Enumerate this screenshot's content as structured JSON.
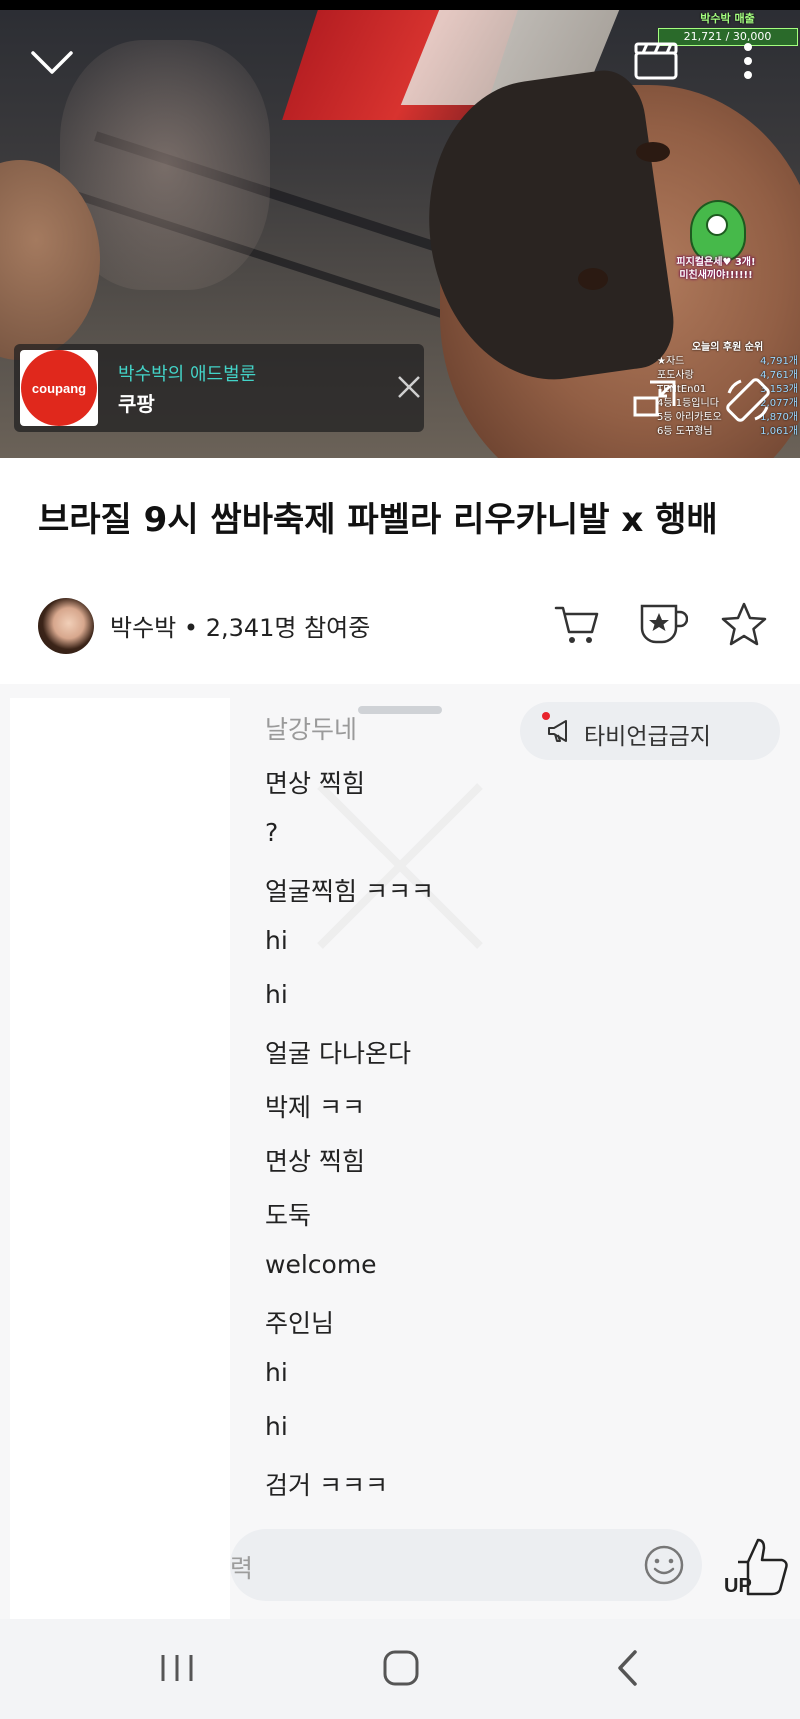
{
  "video": {
    "overlay_top_right": {
      "title": "박수박 매출",
      "value": "21,721",
      "max": "30,000"
    },
    "mascot_text": [
      "피지컬욘세♥ 3개!",
      "미친새끼야!!!!!!"
    ],
    "ranking": {
      "title": "오늘의 후원 순위",
      "rows": [
        {
          "name": "★자드",
          "count": "4,791개"
        },
        {
          "name": "포도사랑",
          "count": "4,761개"
        },
        {
          "name": "TENtEn01",
          "count": "3,153개"
        },
        {
          "name": "4등 1등입니다",
          "count": "2,077개"
        },
        {
          "name": "5등 아리카토오",
          "count": "1,870개"
        },
        {
          "name": "6등 도꾸형님",
          "count": "1,061개"
        }
      ]
    },
    "ad": {
      "logo_text": "coupang",
      "title": "박수박의 애드벌룬",
      "subtitle": "쿠팡"
    },
    "icons": {
      "minimize": "chevron-down-icon",
      "clip": "clapperboard-icon",
      "more": "kebab-icon",
      "pip": "pip-icon",
      "rotate": "rotate-screen-icon"
    }
  },
  "info": {
    "title": "브라질 9시 쌈바축제 파벨라 리우카니발 x 행배",
    "streamer": "박수박",
    "separator": "•",
    "viewers": "2,341명 참여중"
  },
  "chat": {
    "mute_button": "타비언급금지",
    "messages": [
      "날강두네",
      "면상 찍힘",
      "?",
      "얼굴찍힘 ㅋㅋㅋ",
      "hi",
      "hi",
      "얼굴 다나온다",
      "박제 ㅋㅋ",
      "면상 찍힘",
      "도둑",
      "welcome",
      "주인님",
      "hi",
      "hi",
      "검거 ㅋㅋㅋ"
    ],
    "input_placeholder": "력",
    "up_label": "UP"
  },
  "colors": {
    "accent_teal": "#43d3c7",
    "coupang_red": "#e0281c",
    "notify_dot": "#e8232c"
  }
}
